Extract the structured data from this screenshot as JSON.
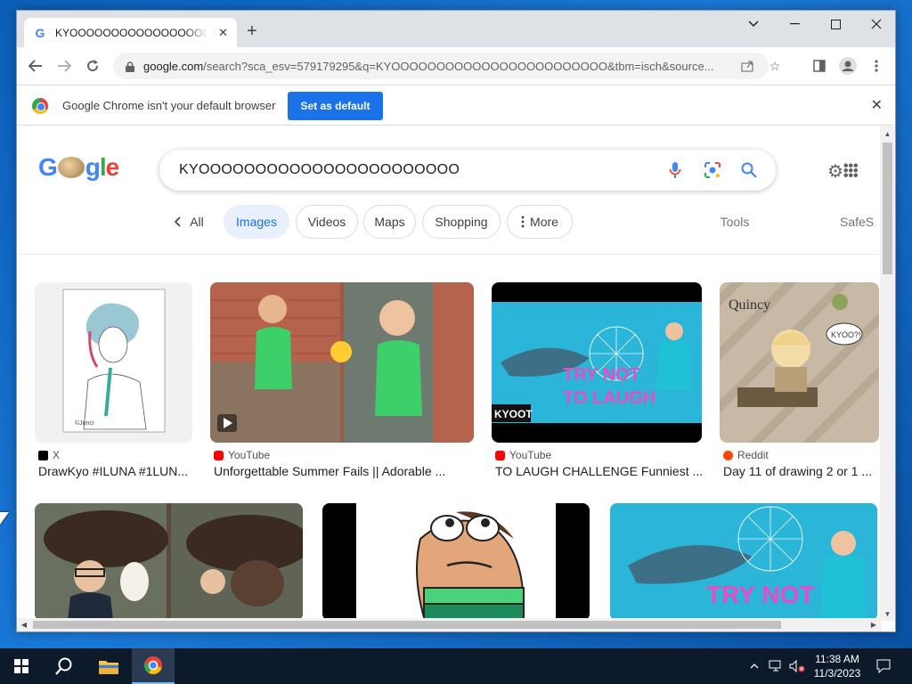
{
  "browser": {
    "tab_title": "KYOOOOOOOOOOOOOOOOOOOOOOOO",
    "tab_favicon": "G",
    "new_tab_symbol": "+",
    "url_main": "google.com",
    "url_rest": "/search?sca_esv=579179295&q=KYOOOOOOOOOOOOOOOOOOOOOOOO&tbm=isch&source...",
    "infobar_message": "Google Chrome isn't your default browser",
    "infobar_button": "Set as default"
  },
  "search": {
    "logo": [
      "G",
      "gle"
    ],
    "query": "KYOOOOOOOOOOOOOOOOOOOOOOO",
    "chips": {
      "back_label": "All",
      "images": "Images",
      "videos": "Videos",
      "maps": "Maps",
      "shopping": "Shopping",
      "more": "More",
      "tools": "Tools",
      "safesearch": "SafeS"
    }
  },
  "results": [
    {
      "source": "X",
      "caption": "DrawKyo #ILUNA #1LUN...",
      "source_color": "#000000"
    },
    {
      "source": "YouTube",
      "caption": "Unforgettable Summer Fails || Adorable ...",
      "source_color": "#ff0000"
    },
    {
      "source": "YouTube",
      "caption": "TO LAUGH CHALLENGE Funniest ...",
      "source_color": "#ff0000"
    },
    {
      "source": "Reddit",
      "caption": "Day 11 of drawing 2 or 1 ...",
      "source_color": "#ff4500"
    }
  ],
  "thumb_text": {
    "try_not": "TRY NOT",
    "to_laugh": "TO LAUGH",
    "kyoot": "KYOOT",
    "quincy": "Quincy",
    "kyoo": "KYOO?!",
    "signature": "©Jonci"
  },
  "taskbar": {
    "time": "11:38 AM",
    "date": "11/3/2023"
  }
}
